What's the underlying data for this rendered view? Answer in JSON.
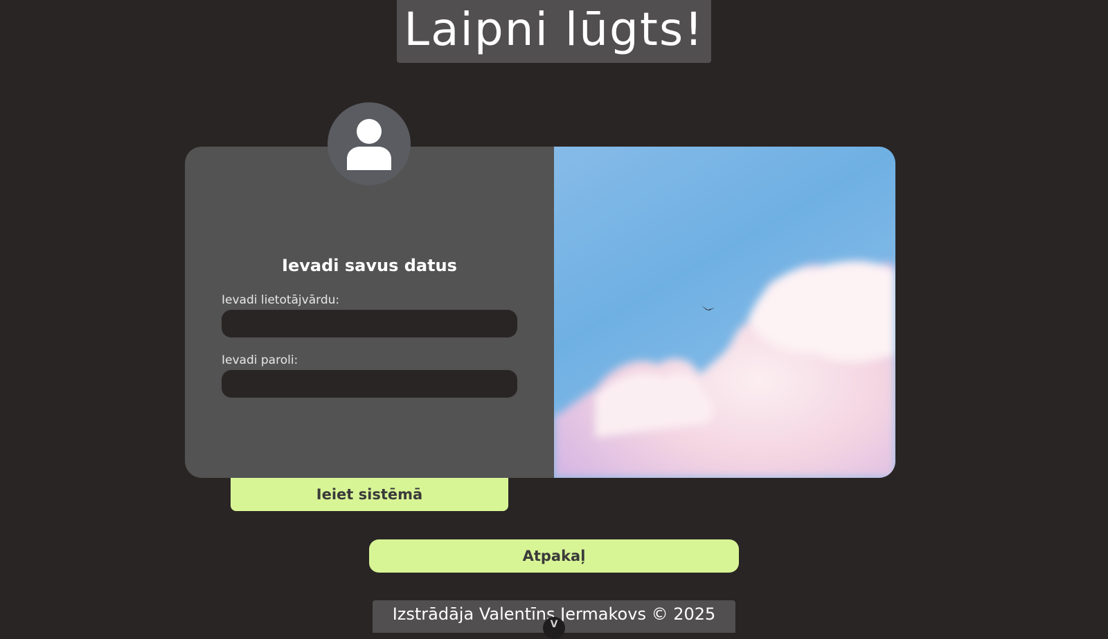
{
  "header": {
    "title": "Laipni lūgts!"
  },
  "form": {
    "heading": "Ievadi savus datus",
    "username_label": "Ievadi lietotājvārdu:",
    "username_value": "",
    "password_label": "Ievadi paroli:",
    "password_value": "",
    "avatar_icon": "user-icon"
  },
  "buttons": {
    "login_label": "Ieiet sistēmā",
    "back_label": "Atpakaļ"
  },
  "footer": {
    "text": "Izstrādāja Valentīns Jermakovs © 2025",
    "toggle_label": "V"
  },
  "colors": {
    "background": "#292524",
    "panel": "#535353",
    "accent": "#d8f596",
    "input": "#292524"
  }
}
